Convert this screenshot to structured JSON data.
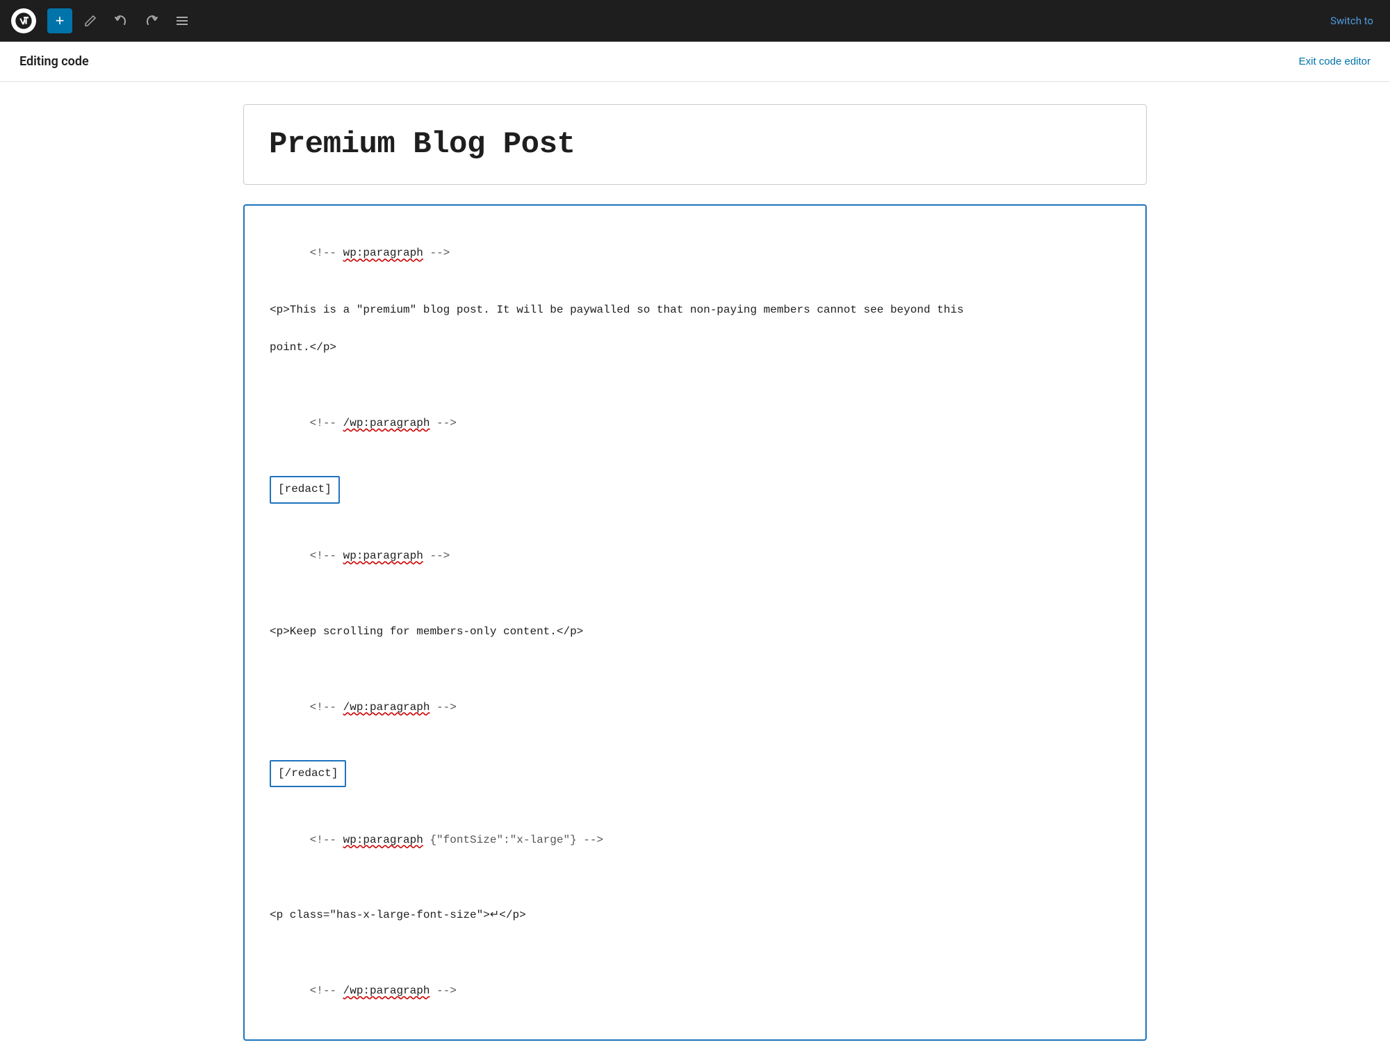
{
  "toolbar": {
    "add_button_label": "+",
    "switch_label": "Switch to",
    "icons": {
      "pencil": "pencil-icon",
      "undo": "undo-icon",
      "redo": "redo-icon",
      "list": "list-icon"
    }
  },
  "sub_header": {
    "editing_code_label": "Editing code",
    "exit_button_label": "Exit code editor"
  },
  "post": {
    "title": "Premium Blog Post"
  },
  "code_editor": {
    "lines": [
      {
        "type": "comment_open",
        "tag": "wp:paragraph",
        "attrs": ""
      },
      {
        "type": "blank"
      },
      {
        "type": "html",
        "content": "<p>This is a \"premium\" blog post. It will be paywalled so that non-paying members cannot see beyond this"
      },
      {
        "type": "blank"
      },
      {
        "type": "html",
        "content": "point.</p>"
      },
      {
        "type": "blank"
      },
      {
        "type": "comment_close",
        "tag": "wp:paragraph",
        "attrs": ""
      },
      {
        "type": "shortcode",
        "content": "[redact]"
      },
      {
        "type": "blank"
      },
      {
        "type": "comment_open",
        "tag": "wp:paragraph",
        "attrs": ""
      },
      {
        "type": "blank"
      },
      {
        "type": "html",
        "content": "<p>Keep scrolling for members-only content.</p>"
      },
      {
        "type": "blank"
      },
      {
        "type": "comment_close",
        "tag": "wp:paragraph",
        "attrs": ""
      },
      {
        "type": "shortcode",
        "content": "[/redact]"
      },
      {
        "type": "blank"
      },
      {
        "type": "comment_open",
        "tag": "wp:paragraph",
        "attrs": " {\"fontSize\":\"x-large\"}"
      },
      {
        "type": "blank"
      },
      {
        "type": "html",
        "content": "<p class=\"has-x-large-font-size\">↵</p>"
      },
      {
        "type": "blank"
      },
      {
        "type": "comment_close",
        "tag": "wp:paragraph",
        "attrs": ""
      }
    ]
  }
}
